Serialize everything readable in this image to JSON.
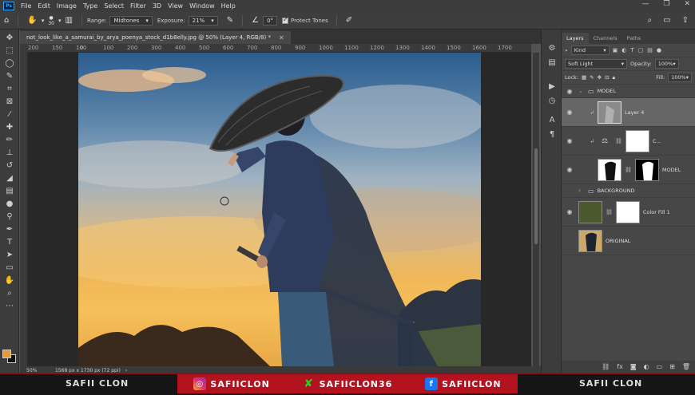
{
  "menubar": {
    "logo": "Ps",
    "items": [
      "File",
      "Edit",
      "Image",
      "Type",
      "Select",
      "Filter",
      "3D",
      "View",
      "Window",
      "Help"
    ]
  },
  "options": {
    "brush_size": "30",
    "range_label": "Range:",
    "range_value": "Midtones",
    "exposure_label": "Exposure:",
    "exposure_value": "21%",
    "angle_value": "0°",
    "protect_tones": "Protect Tones"
  },
  "document": {
    "tab_title": "not_look_like_a_samurai_by_arya_poenya_stock_d1b8elly.jpg @ 50% (Layer 4, RGB/8) *",
    "zoom": "50%",
    "doc_info": "1568 px x 1730 px (72 ppi)"
  },
  "ruler": {
    "ticks": [
      "200",
      "150",
      "100",
      "0",
      "100",
      "200",
      "300",
      "400",
      "500",
      "600",
      "700",
      "800",
      "900",
      "1000",
      "1100",
      "1200",
      "1300",
      "1400",
      "1500",
      "1600",
      "1700"
    ]
  },
  "layers_panel": {
    "tabs": [
      "Layers",
      "Channels",
      "Paths"
    ],
    "filter_kind": "Kind",
    "blend_mode": "Soft Light",
    "opacity_label": "Opacity:",
    "opacity_value": "100%",
    "lock_label": "Lock:",
    "fill_label": "Fill:",
    "fill_value": "100%",
    "layers": [
      {
        "name": "MODEL",
        "type": "group",
        "visible": true
      },
      {
        "name": "Layer 4",
        "type": "layer",
        "visible": true,
        "selected": true
      },
      {
        "name": "C...",
        "type": "adjustment",
        "visible": true
      },
      {
        "name": "MODEL",
        "type": "layer-mask",
        "visible": true
      },
      {
        "name": "BACKGROUND",
        "type": "group",
        "visible": true
      },
      {
        "name": "Color Fill 1",
        "type": "fill",
        "visible": true
      },
      {
        "name": "ORIGINAL",
        "type": "layer",
        "visible": false
      }
    ]
  },
  "brand": {
    "left": "SAFII CLON",
    "instagram": "SAFIICLON",
    "xbox": "SAFIICLON36",
    "facebook": "SAFIICLON",
    "right": "SAFII CLON"
  },
  "colors": {
    "foreground": "#e39a3b",
    "background": "#111111",
    "brand_red": "#b3121f"
  }
}
